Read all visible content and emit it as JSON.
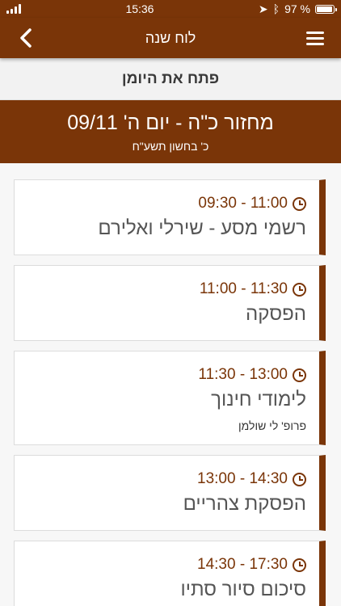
{
  "status": {
    "time": "15:36",
    "battery": "97 %",
    "battery_level": 0.97
  },
  "nav": {
    "title": "לוח שנה"
  },
  "open_diary": "פתח את היומן",
  "day": {
    "title": "מחזור כ\"ה - יום ה' 09/11",
    "hebrew_date": "כ' בחשון תשע\"ח"
  },
  "events": [
    {
      "time": "11:00 - 09:30",
      "title": "רשמי מסע - שירלי ואלירם"
    },
    {
      "time": "11:30 - 11:00",
      "title": "הפסקה"
    },
    {
      "time": "13:00 - 11:30",
      "title": "לימודי חינוך",
      "subtitle": "פרופ' לי שולמן"
    },
    {
      "time": "14:30 - 13:00",
      "title": "הפסקת צהריים"
    },
    {
      "time": "17:30 - 14:30",
      "title": "סיכום סיור סתיו"
    }
  ],
  "colors": {
    "brand": "#7a3508"
  }
}
